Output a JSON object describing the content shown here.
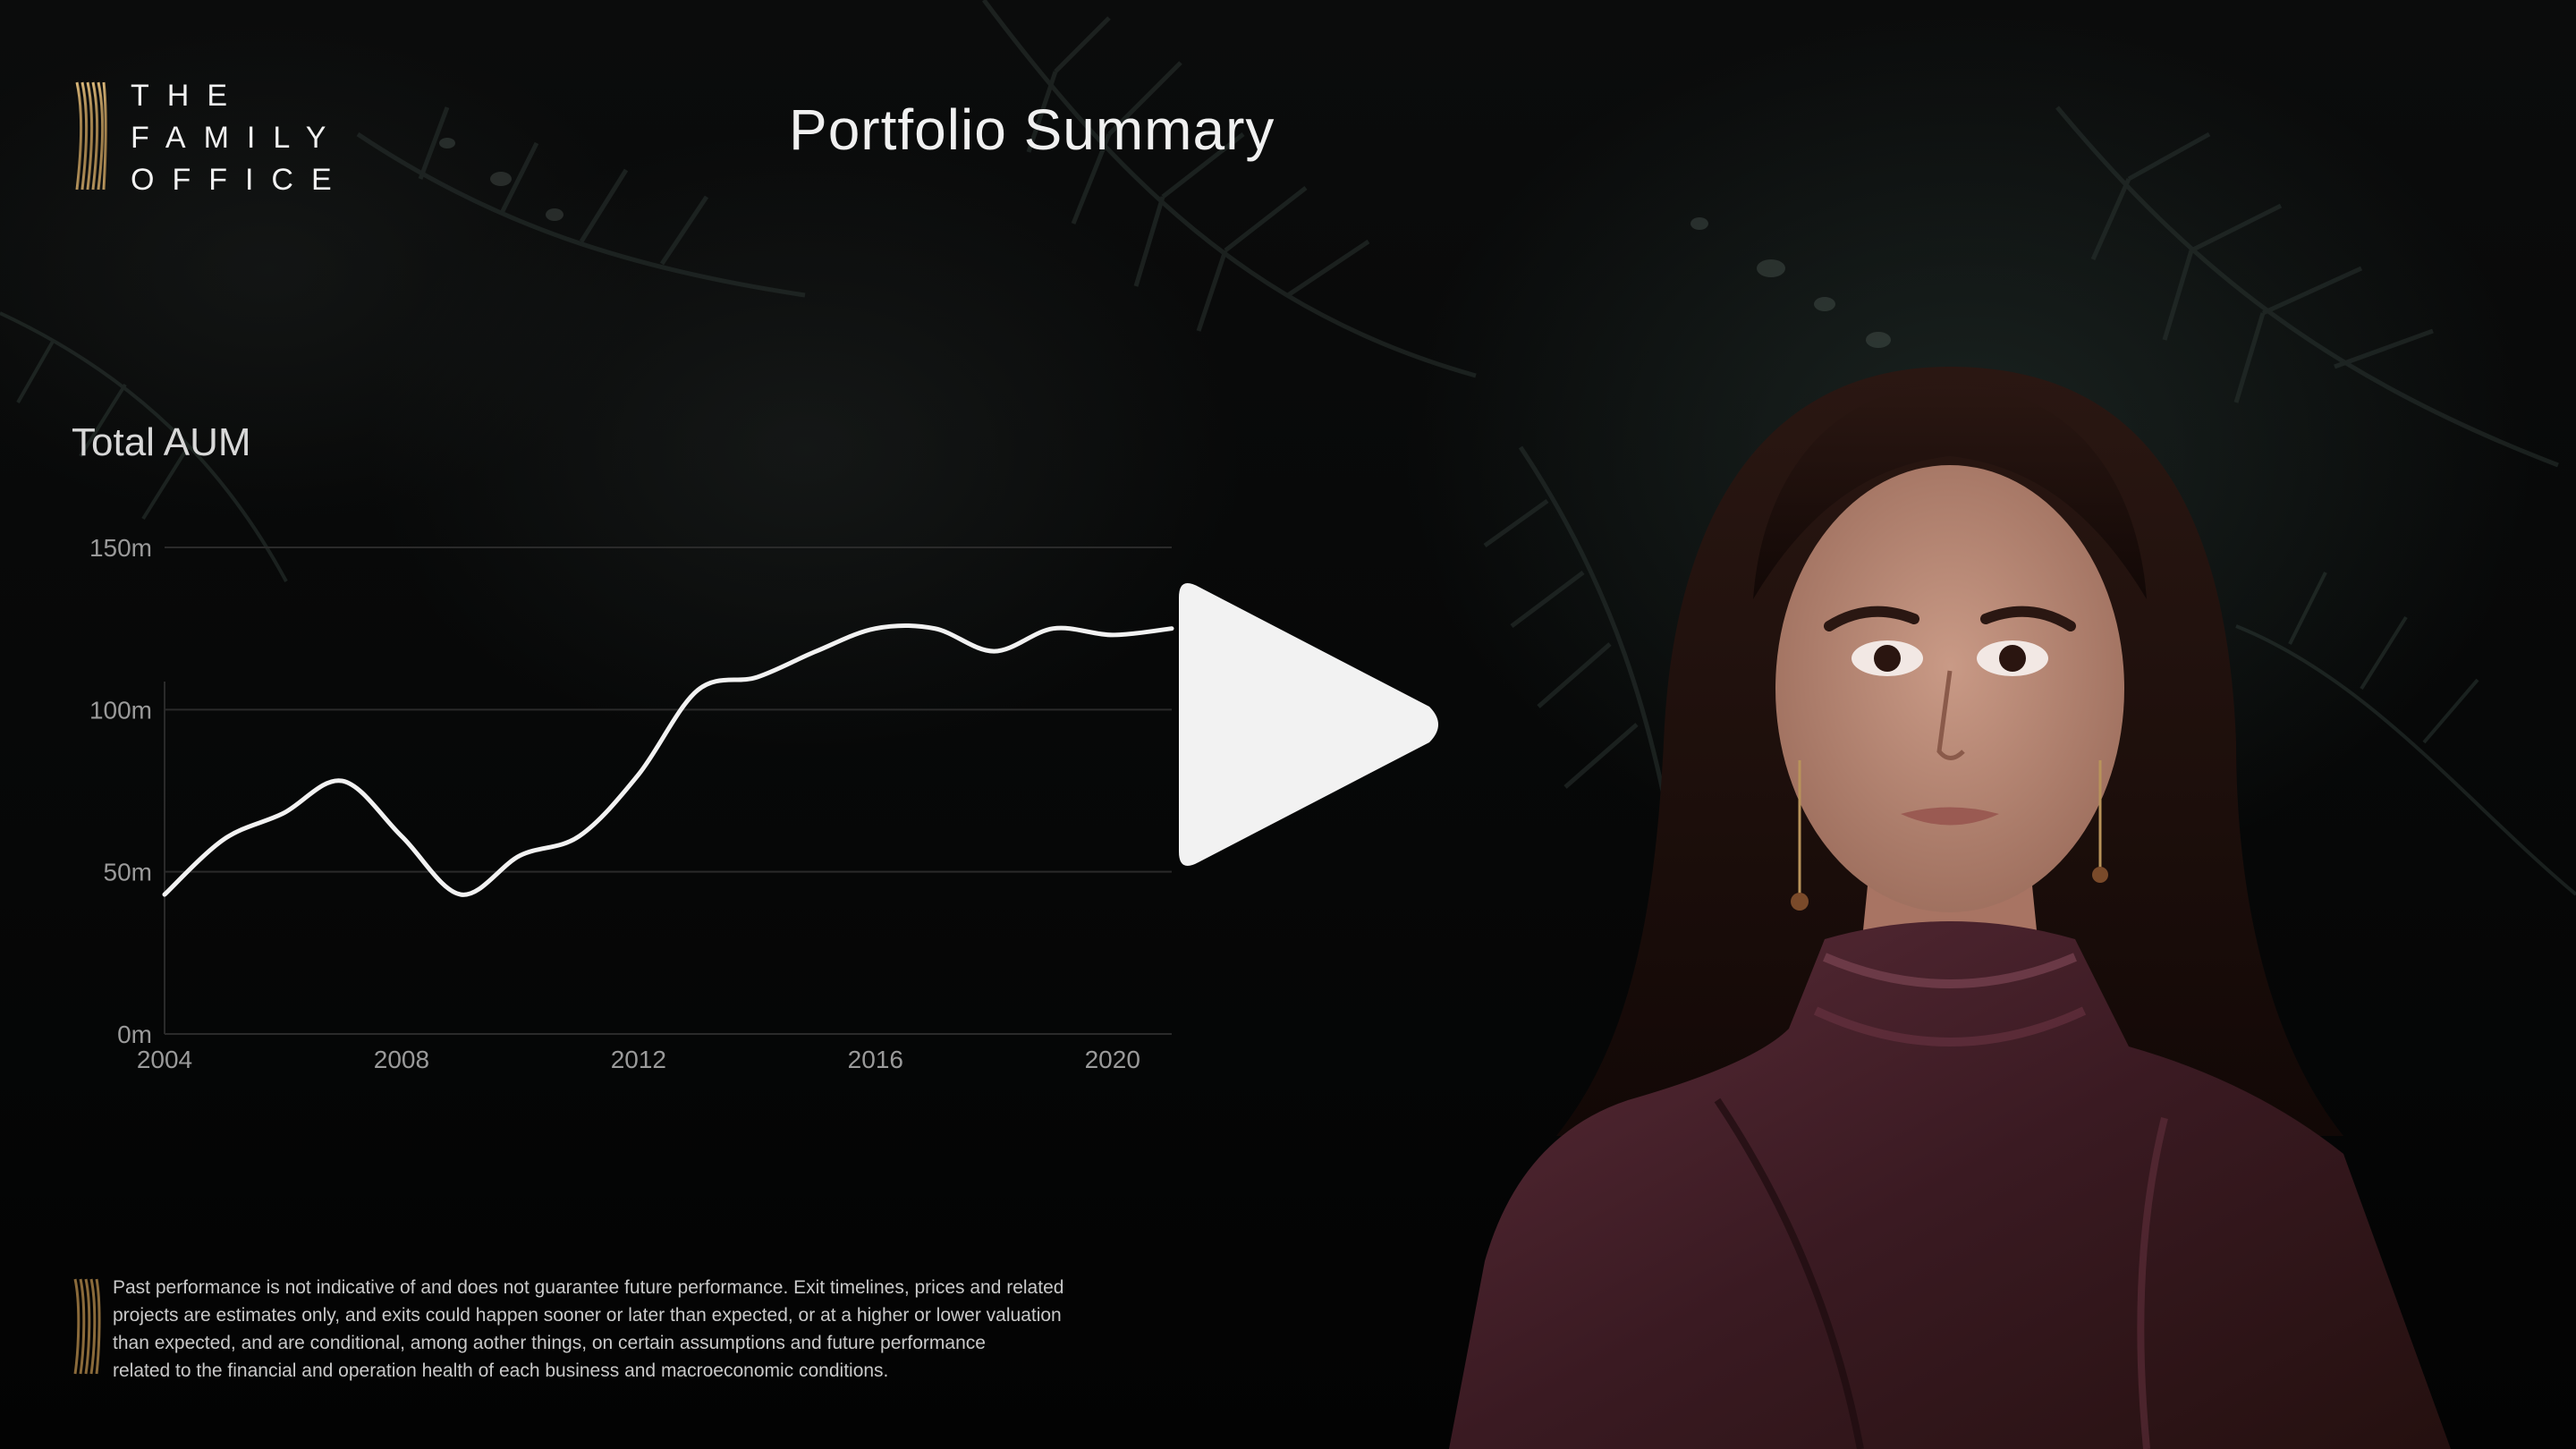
{
  "brand": {
    "line1": "THE",
    "line2": "FAMILY",
    "line3": "OFFICE",
    "mark_icon": "striped-leaf-logo-icon"
  },
  "slide": {
    "title": "Portfolio Summary"
  },
  "chart_data": {
    "type": "line",
    "title": "Total AUM",
    "xlabel": "",
    "ylabel": "",
    "x_ticks": [
      "2004",
      "2008",
      "2012",
      "2016",
      "2020"
    ],
    "y_ticks": [
      "0m",
      "50m",
      "100m",
      "150m"
    ],
    "xlim": [
      2004,
      2021
    ],
    "ylim": [
      0,
      150
    ],
    "grid": true,
    "series": [
      {
        "x": [
          2004,
          2005,
          2006,
          2007,
          2008,
          2009,
          2010,
          2011,
          2012,
          2013,
          2014,
          2015,
          2016,
          2017,
          2018,
          2019,
          2020,
          2021
        ],
        "values": [
          43,
          60,
          68,
          78,
          61,
          43,
          55,
          61,
          80,
          106,
          110,
          118,
          125,
          125,
          118,
          125,
          123,
          125
        ]
      }
    ],
    "colors": {
      "line": "#f2f2f2",
      "grid": "#2a2a2a",
      "ticks": "#9a9a9a"
    }
  },
  "player": {
    "play_icon": "play-icon"
  },
  "disclaimer": {
    "line1": "Past performance is not indicative of and does not guarantee future performance. Exit timelines, prices and related",
    "line2": "projects are estimates only, and exits could happen sooner or later than expected, or at a higher or lower valuation",
    "line3": "than expected, and are conditional, among aother things, on certain assumptions and future performance",
    "line4": "related to the financial and operation health of each business and macroeconomic conditions."
  },
  "theme": {
    "background": "#050505",
    "gold": "#b8935a",
    "blouse": "#3a1c24"
  }
}
